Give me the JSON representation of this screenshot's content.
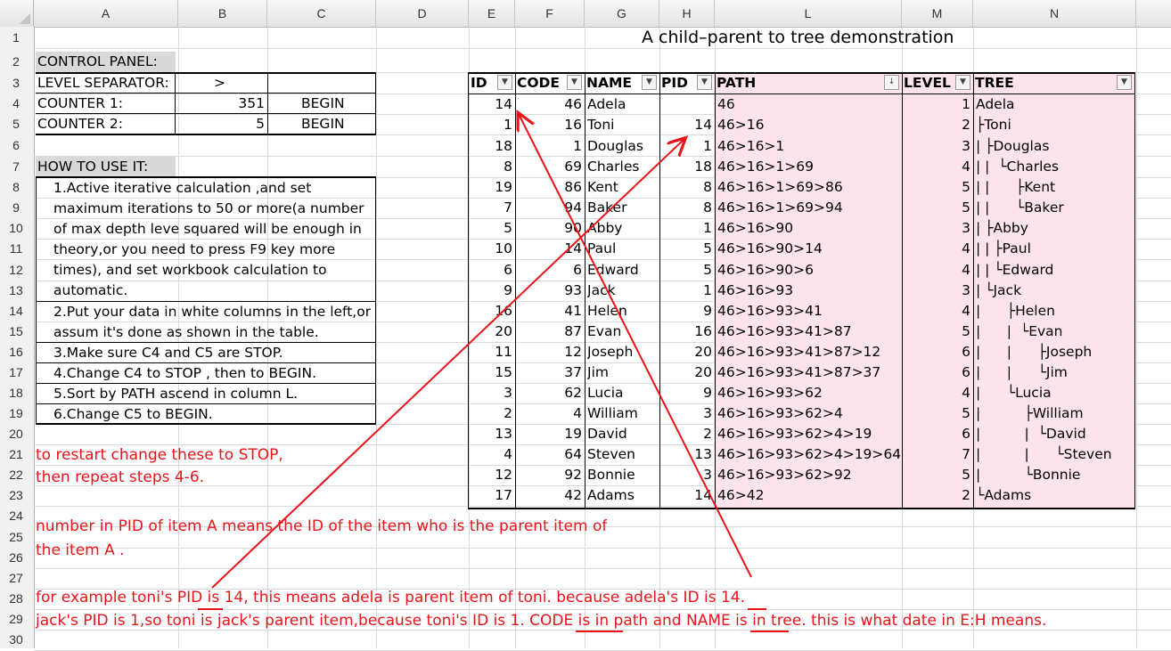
{
  "columns": [
    "A",
    "B",
    "C",
    "D",
    "E",
    "F",
    "G",
    "H",
    "L",
    "M",
    "N"
  ],
  "rows": [
    "1",
    "2",
    "3",
    "4",
    "5",
    "6",
    "7",
    "8",
    "9",
    "10",
    "11",
    "12",
    "13",
    "14",
    "15",
    "16",
    "17",
    "18",
    "19",
    "20",
    "21",
    "22",
    "23",
    "24",
    "25",
    "26",
    "27",
    "28",
    "29",
    "30"
  ],
  "title": "A child–parent to tree demonstration",
  "control_panel": {
    "heading": "CONTROL PANEL:",
    "level_separator_label": "LEVEL SEPARATOR:",
    "level_separator_value": ">",
    "counter1_label": "COUNTER 1:",
    "counter1_value": "351",
    "counter1_state": "BEGIN",
    "counter2_label": "COUNTER 2:",
    "counter2_value": "5",
    "counter2_state": "BEGIN"
  },
  "how_to": {
    "heading": "HOW TO USE IT:",
    "lines": [
      "1.Active iterative calculation ,and set",
      "maximum iterations to 50 or more(a number",
      "of max depth leve squared will be enough in",
      "theory,or you need to press F9 key more",
      "times), and set workbook calculation to",
      "automatic.",
      "2.Put your data in white columns in the left,or",
      "assum it's done as shown in the table.",
      "3.Make sure C4 and C5 are STOP.",
      "4.Change C4 to STOP , then to BEGIN.",
      "5.Sort by PATH ascend in column L.",
      "6.Change C5 to BEGIN."
    ]
  },
  "table": {
    "headers": [
      "ID",
      "CODE",
      "NAME",
      "PID",
      "PATH",
      "LEVEL",
      "TREE"
    ],
    "rows": [
      [
        "14",
        "46",
        "Adela",
        "",
        "46",
        "1",
        "Adela"
      ],
      [
        "1",
        "16",
        "Toni",
        "14",
        "46>16",
        "2",
        "├Toni"
      ],
      [
        "18",
        "1",
        "Douglas",
        "1",
        "46>16>1",
        "3",
        "| ├Douglas"
      ],
      [
        "8",
        "69",
        "Charles",
        "18",
        "46>16>1>69",
        "4",
        "| |  └Charles"
      ],
      [
        "19",
        "86",
        "Kent",
        "8",
        "46>16>1>69>86",
        "5",
        "| |      ├Kent"
      ],
      [
        "7",
        "94",
        "Baker",
        "8",
        "46>16>1>69>94",
        "5",
        "| |      └Baker"
      ],
      [
        "5",
        "90",
        "Abby",
        "1",
        "46>16>90",
        "3",
        "| ├Abby"
      ],
      [
        "10",
        "14",
        "Paul",
        "5",
        "46>16>90>14",
        "4",
        "| | ├Paul"
      ],
      [
        "6",
        "6",
        "Edward",
        "5",
        "46>16>90>6",
        "4",
        "| | └Edward"
      ],
      [
        "9",
        "93",
        "Jack",
        "1",
        "46>16>93",
        "3",
        "| └Jack"
      ],
      [
        "16",
        "41",
        "Helen",
        "9",
        "46>16>93>41",
        "4",
        "|      ├Helen"
      ],
      [
        "20",
        "87",
        "Evan",
        "16",
        "46>16>93>41>87",
        "5",
        "|      |  └Evan"
      ],
      [
        "11",
        "12",
        "Joseph",
        "20",
        "46>16>93>41>87>12",
        "6",
        "|      |      ├Joseph"
      ],
      [
        "15",
        "37",
        "Jim",
        "20",
        "46>16>93>41>87>37",
        "6",
        "|      |      └Jim"
      ],
      [
        "3",
        "62",
        "Lucia",
        "9",
        "46>16>93>62",
        "4",
        "|      └Lucia"
      ],
      [
        "2",
        "4",
        "William",
        "3",
        "46>16>93>62>4",
        "5",
        "|          ├William"
      ],
      [
        "13",
        "19",
        "David",
        "2",
        "46>16>93>62>4>19",
        "6",
        "|          |  └David"
      ],
      [
        "4",
        "64",
        "Steven",
        "13",
        "46>16>93>62>4>19>64",
        "7",
        "|          |      └Steven"
      ],
      [
        "12",
        "92",
        "Bonnie",
        "3",
        "46>16>93>62>92",
        "5",
        "|          └Bonnie"
      ],
      [
        "17",
        "42",
        "Adams",
        "14",
        "46>42",
        "2",
        "└Adams"
      ]
    ]
  },
  "notes": {
    "restart1": "to restart change these to STOP,",
    "restart2": "then repeat steps 4-6.",
    "pid1": "number in PID of item A means the ID of the item who is the parent item of",
    "pid2": "the item A .",
    "example1": "for example toni's PID is 14, this means adela is parent item of toni. because adela's ID is 14.",
    "example2": "jack's PID is 1,so toni is jack's parent item,because toni's ID is 1. CODE is in path and NAME is in tree. this is what date in E:H means."
  },
  "colors": {
    "pink": "#fde4ec",
    "annotation_red": "#e8141a",
    "grey_header": "#d9d9d9"
  }
}
